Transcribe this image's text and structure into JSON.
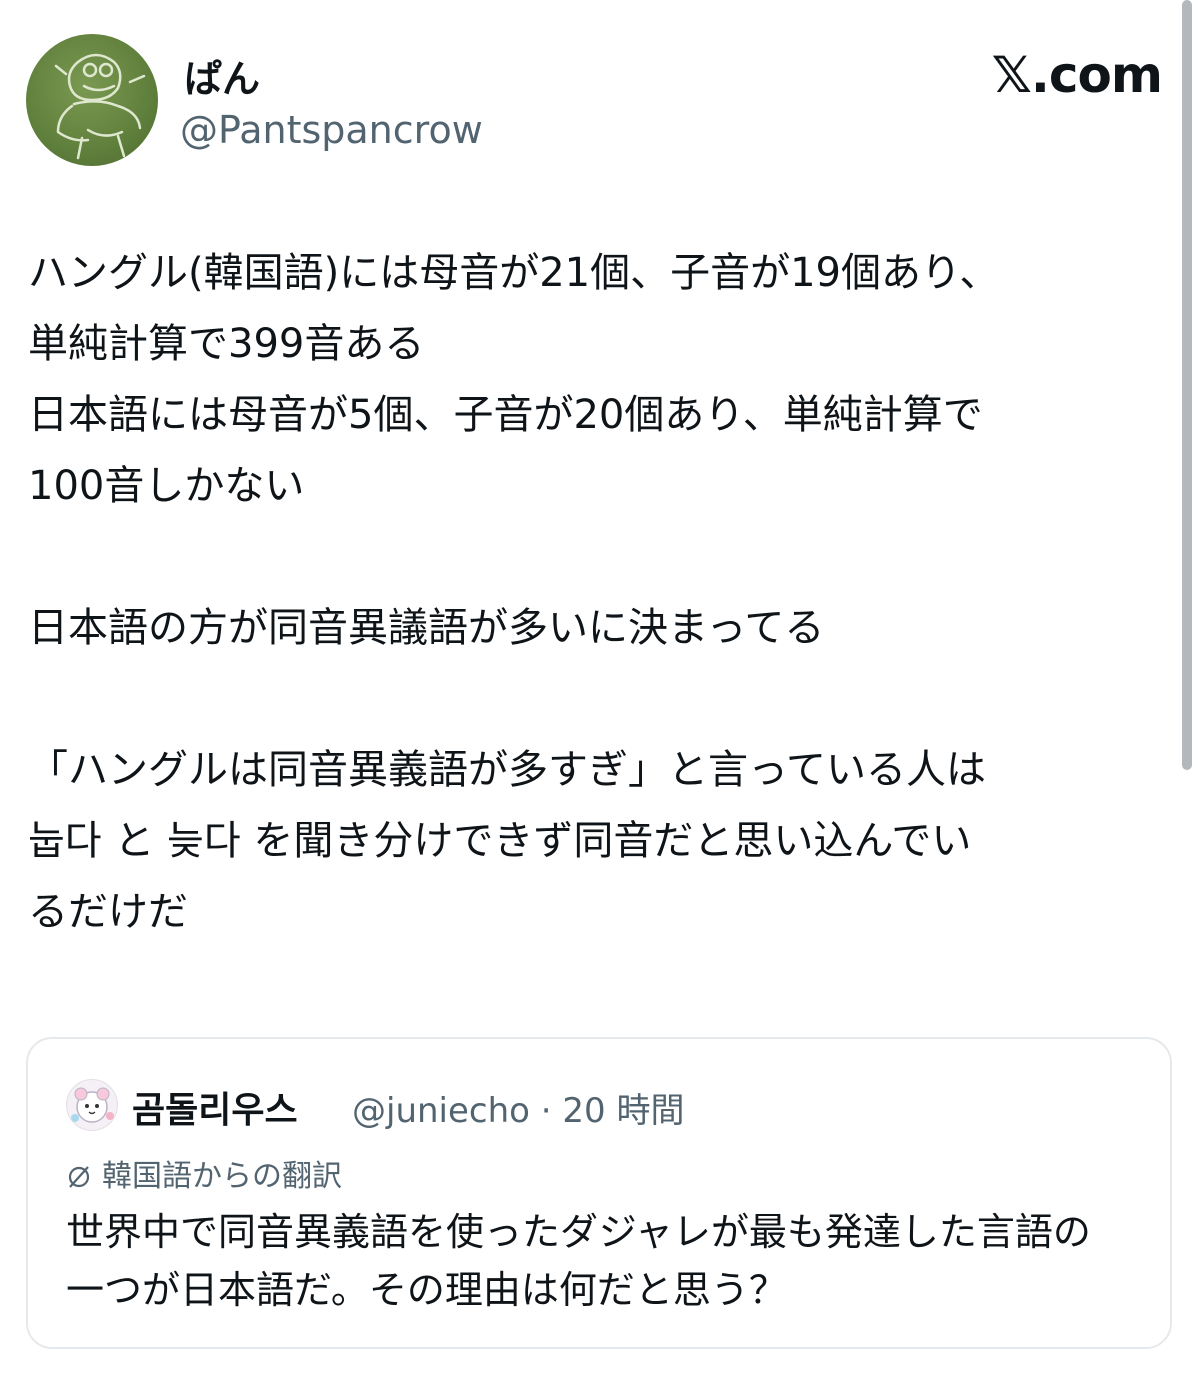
{
  "author": {
    "display_name": "ぱん",
    "handle": "@Pantspancrow"
  },
  "brand": "𝕏.com",
  "tweet": {
    "text": "ハングル(韓国語)には母音が21個、子音が19個あり、\n単純計算で399音ある\n日本語には母音が5個、子音が20個あり、単純計算で\n100音しかない\n\n日本語の方が同音異議語が多いに決まってる\n\n「ハングルは同音異義語が多すぎ」と言っている人は\n눕다 と 늦다 を聞き分けできず同音だと思い込んでい\nるだけだ"
  },
  "quote": {
    "display_name": "곰돌리우스",
    "meta": "@juniecho · 20 時間",
    "translation_label": "韓国語からの翻訳",
    "text": "世界中で同音異義語を使ったダジャレが最も発達した言語の一つが日本語だ。その理由は何だと思う？"
  },
  "colors": {
    "text": "#0f1419",
    "secondary": "#536471",
    "border": "#e6e9ec",
    "avatar_green": "#5f7f3c"
  },
  "icons": {
    "avatar": "cartoon-frog-avatar",
    "quote_avatar": "bear-avatar",
    "translate": "slashed-circle-icon"
  }
}
